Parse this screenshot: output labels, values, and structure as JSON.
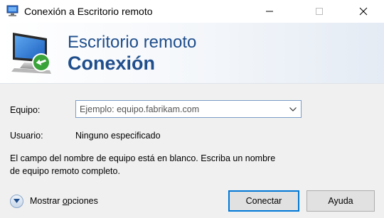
{
  "window": {
    "title": "Conexión a Escritorio remoto",
    "controls": {
      "minimize": "minimize-icon",
      "maximize": "maximize-icon",
      "close": "close-icon"
    }
  },
  "banner": {
    "line1": "Escritorio remoto",
    "line2": "Conexión",
    "icon": "remote-desktop-monitor-icon"
  },
  "form": {
    "computer_label": "Equipo:",
    "computer_value": "",
    "computer_placeholder": "Ejemplo: equipo.fabrikam.com",
    "user_label": "Usuario:",
    "user_value": "Ninguno especificado"
  },
  "message": "El campo del nombre de equipo está en blanco. Escriba un nombre de equipo remoto completo.",
  "footer": {
    "options_prefix": "Mostrar ",
    "options_underlined": "o",
    "options_suffix": "pciones",
    "connect_label": "Conectar",
    "help_label": "Ayuda"
  },
  "colors": {
    "accent": "#0078d7",
    "banner_text": "#1f4e8c"
  }
}
